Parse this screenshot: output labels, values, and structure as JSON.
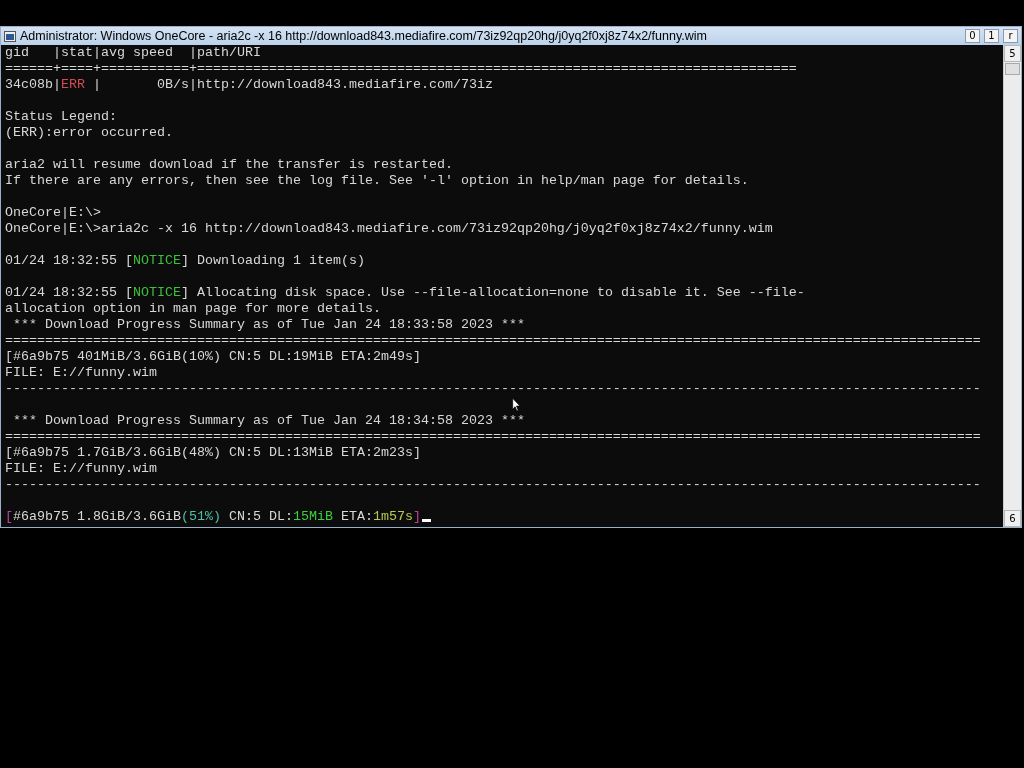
{
  "window": {
    "title": "Administrator:  Windows OneCore - aria2c  -x 16 http://download843.mediafire.com/73iz92qp20hg/j0yq2f0xj8z74x2/funny.wim",
    "buttons": [
      "0",
      "1",
      "r"
    ]
  },
  "scrollbar": {
    "up": "5",
    "down": "6"
  },
  "console": {
    "lines": [
      {
        "kind": "text",
        "spans": [
          {
            "text": "gid   |stat|avg speed  |path/URI"
          }
        ]
      },
      {
        "kind": "text",
        "spans": [
          {
            "text": "======+====+===========+==========================================================================="
          }
        ]
      },
      {
        "kind": "text",
        "spans": [
          {
            "text": "34c08b|"
          },
          {
            "text": "ERR ",
            "color": "#d24a52"
          },
          {
            "text": "|       0B/s|http://download843.mediafire.com/73iz"
          }
        ]
      },
      {
        "kind": "blank"
      },
      {
        "kind": "text",
        "spans": [
          {
            "text": "Status Legend:"
          }
        ]
      },
      {
        "kind": "text",
        "spans": [
          {
            "text": "(ERR):error occurred."
          }
        ]
      },
      {
        "kind": "blank"
      },
      {
        "kind": "text",
        "spans": [
          {
            "text": "aria2 will resume download if the transfer is restarted."
          }
        ]
      },
      {
        "kind": "text",
        "spans": [
          {
            "text": "If there are any errors, then see the log file. See '-l' option in help/man page for details."
          }
        ]
      },
      {
        "kind": "blank"
      },
      {
        "kind": "text",
        "spans": [
          {
            "text": "OneCore|E:\\>"
          }
        ]
      },
      {
        "kind": "text",
        "spans": [
          {
            "text": "OneCore|E:\\>aria2c -x 16 http://download843.mediafire.com/73iz92qp20hg/j0yq2f0xj8z74x2/funny.wim"
          }
        ]
      },
      {
        "kind": "blank"
      },
      {
        "kind": "text",
        "spans": [
          {
            "text": "01/24 18:32:55 ["
          },
          {
            "text": "NOTICE",
            "color": "#3cbf3c"
          },
          {
            "text": "] Downloading 1 item(s)"
          }
        ]
      },
      {
        "kind": "blank"
      },
      {
        "kind": "text",
        "spans": [
          {
            "text": "01/24 18:32:55 ["
          },
          {
            "text": "NOTICE",
            "color": "#3cbf3c"
          },
          {
            "text": "] Allocating disk space. Use --file-allocation=none to disable it. See --file-"
          }
        ]
      },
      {
        "kind": "text",
        "spans": [
          {
            "text": "allocation option in man page for more details."
          }
        ]
      },
      {
        "kind": "text",
        "spans": [
          {
            "text": " *** Download Progress Summary as of Tue Jan 24 18:33:58 2023 ***"
          }
        ]
      },
      {
        "kind": "text",
        "spans": [
          {
            "text": "=========================================================================================================================="
          }
        ]
      },
      {
        "kind": "text",
        "spans": [
          {
            "text": "[#6a9b75 401MiB/3.6GiB(10%) CN:5 DL:19MiB ETA:2m49s]"
          }
        ]
      },
      {
        "kind": "text",
        "spans": [
          {
            "text": "FILE: E://funny.wim"
          }
        ]
      },
      {
        "kind": "text",
        "spans": [
          {
            "text": "--------------------------------------------------------------------------------------------------------------------------"
          }
        ]
      },
      {
        "kind": "blank"
      },
      {
        "kind": "text",
        "spans": [
          {
            "text": " *** Download Progress Summary as of Tue Jan 24 18:34:58 2023 ***"
          }
        ]
      },
      {
        "kind": "text",
        "spans": [
          {
            "text": "=========================================================================================================================="
          }
        ]
      },
      {
        "kind": "text",
        "spans": [
          {
            "text": "[#6a9b75 1.7GiB/3.6GiB(48%) CN:5 DL:13MiB ETA:2m23s]"
          }
        ]
      },
      {
        "kind": "text",
        "spans": [
          {
            "text": "FILE: E://funny.wim"
          }
        ]
      },
      {
        "kind": "text",
        "spans": [
          {
            "text": "--------------------------------------------------------------------------------------------------------------------------"
          }
        ]
      },
      {
        "kind": "blank"
      },
      {
        "kind": "text",
        "spans": [
          {
            "text": "[",
            "color": "#c040a0"
          },
          {
            "text": "#6a9b75 1.8GiB/3.6GiB"
          },
          {
            "text": "(51%)",
            "color": "#4fc0a0"
          },
          {
            "text": " CN:5 DL:"
          },
          {
            "text": "15MiB",
            "color": "#3ccf3c"
          },
          {
            "text": " ETA:"
          },
          {
            "text": "1m57s",
            "color": "#b8c850"
          },
          {
            "text": "]",
            "color": "#c040a0"
          }
        ]
      }
    ],
    "cursor": true
  }
}
